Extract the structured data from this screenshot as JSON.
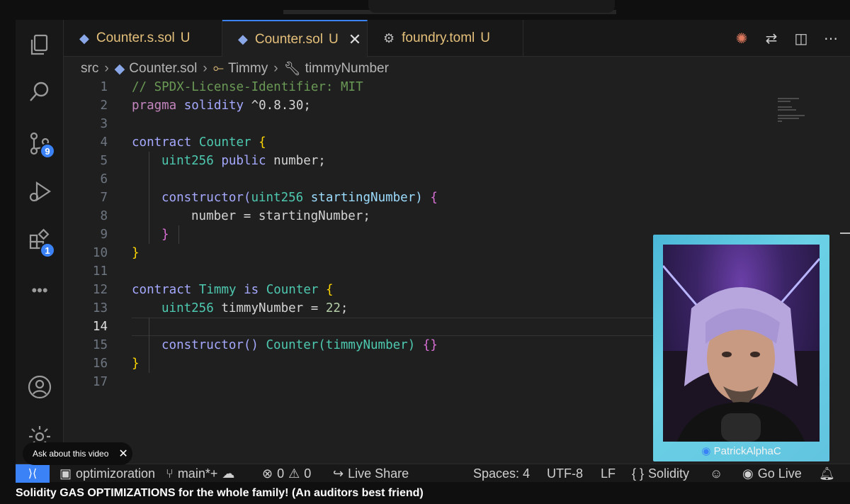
{
  "tabs": [
    {
      "label": "Counter.s.sol",
      "status": "U",
      "icon": "ethereum-icon",
      "active": false
    },
    {
      "label": "Counter.sol",
      "status": "U",
      "icon": "ethereum-icon",
      "active": true
    },
    {
      "label": "foundry.toml",
      "status": "U",
      "icon": "gear-icon",
      "active": false
    }
  ],
  "tab_close": "✕",
  "breadcrumb": [
    "src",
    "Counter.sol",
    "Timmy",
    "timmyNumber"
  ],
  "activity_badges": {
    "source_control": "9",
    "extensions": "1"
  },
  "editor": {
    "current_line": 14,
    "line_numbers": [
      "1",
      "2",
      "3",
      "4",
      "5",
      "6",
      "7",
      "8",
      "9",
      "10",
      "11",
      "12",
      "13",
      "14",
      "15",
      "16",
      "17"
    ],
    "lines": {
      "l1": "// SPDX-License-Identifier: MIT",
      "l2_kw": "pragma",
      "l2_kw2": "solidity",
      "l2_ver": "^0.8.30;",
      "l4_kw": "contract",
      "l4_name": "Counter",
      "l4_brace": "{",
      "l5_type": "uint256",
      "l5_kw": "public",
      "l5_var": "number;",
      "l7_fn": "constructor(",
      "l7_type": "uint256",
      "l7_arg": "startingNumber)",
      "l7_brace": "{",
      "l8": "number = startingNumber;",
      "l9": "}",
      "l10": "}",
      "l12_kw": "contract",
      "l12_name": "Timmy",
      "l12_is": "is",
      "l12_base": "Counter",
      "l12_brace": "{",
      "l13_type": "uint256",
      "l13_var": "timmyNumber =",
      "l13_num": "22",
      "l13_end": ";",
      "l15_fn": "constructor()",
      "l15_base": "Counter(timmyNumber)",
      "l15_braces": "{}",
      "l16": "}"
    }
  },
  "webcam": {
    "channel_name": "PatrickAlphaC"
  },
  "status_bar": {
    "workspace": "optimizoration",
    "branch": "main*+",
    "errors": "0",
    "warnings": "0",
    "live_share": "Live Share",
    "spaces": "Spaces: 4",
    "encoding": "UTF-8",
    "eol": "LF",
    "language": "Solidity",
    "go_live": "Go Live"
  },
  "tooltip": {
    "label": "Ask about this video",
    "close": "✕"
  },
  "video_title": "Solidity GAS OPTIMIZATIONS for the whole family! (An auditors best friend)",
  "colors": {
    "accent": "#3b82f6",
    "editor_bg": "#1f1f1f",
    "sidebar_bg": "#181818"
  }
}
